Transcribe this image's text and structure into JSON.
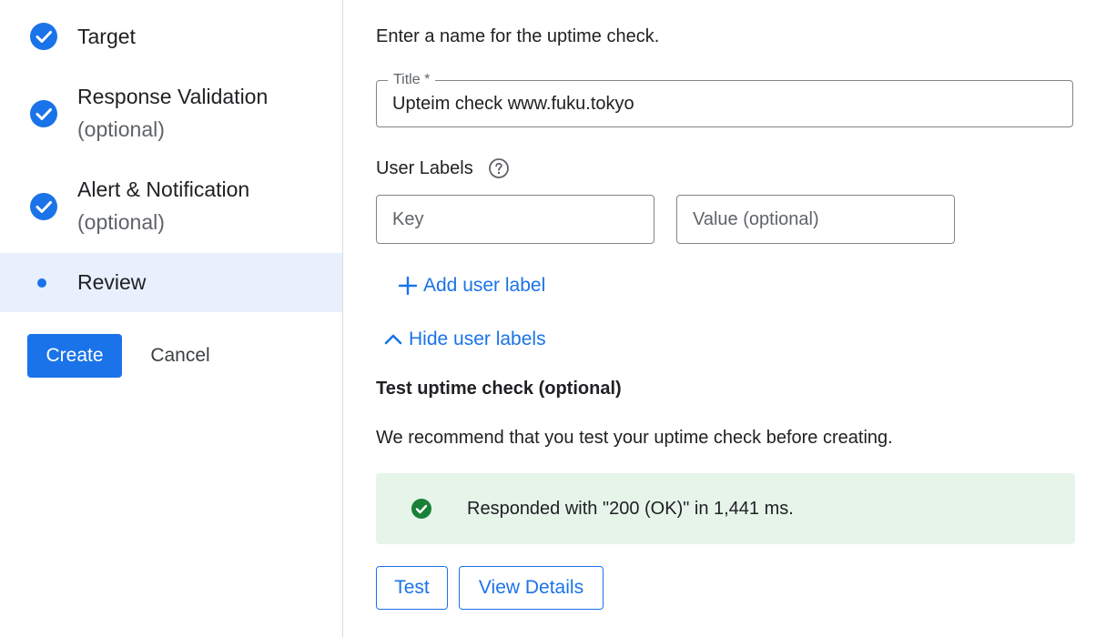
{
  "stepper": {
    "steps": [
      {
        "title": "Target",
        "subtitle": "",
        "state": "complete",
        "icon": "check-circle-icon"
      },
      {
        "title": "Response Validation",
        "subtitle": "(optional)",
        "state": "complete",
        "icon": "check-circle-icon"
      },
      {
        "title": "Alert & Notification",
        "subtitle": "(optional)",
        "state": "complete",
        "icon": "check-circle-icon"
      },
      {
        "title": "Review",
        "subtitle": "",
        "state": "active",
        "icon": "dot-icon"
      }
    ],
    "create_label": "Create",
    "cancel_label": "Cancel"
  },
  "form": {
    "intro": "Enter a name for the uptime check.",
    "title_field": {
      "label": "Title *",
      "value": "Upteim check www.fuku.tokyo"
    },
    "user_labels": {
      "heading": "User Labels",
      "help_icon": "help-circle-icon",
      "key_placeholder": "Key",
      "value_placeholder": "Value (optional)",
      "add_label": "Add user label",
      "hide_label": "Hide user labels"
    },
    "test": {
      "heading": "Test uptime check (optional)",
      "recommendation": "We recommend that you test your uptime check before creating.",
      "result": "Responded with \"200 (OK)\" in 1,441 ms.",
      "result_icon": "check-circle-icon",
      "test_label": "Test",
      "view_details_label": "View Details"
    }
  },
  "colors": {
    "accent": "#1a73e8",
    "active_step_bg": "#e8f0fe",
    "success": "#188038",
    "success_bg": "#e6f4ea"
  }
}
